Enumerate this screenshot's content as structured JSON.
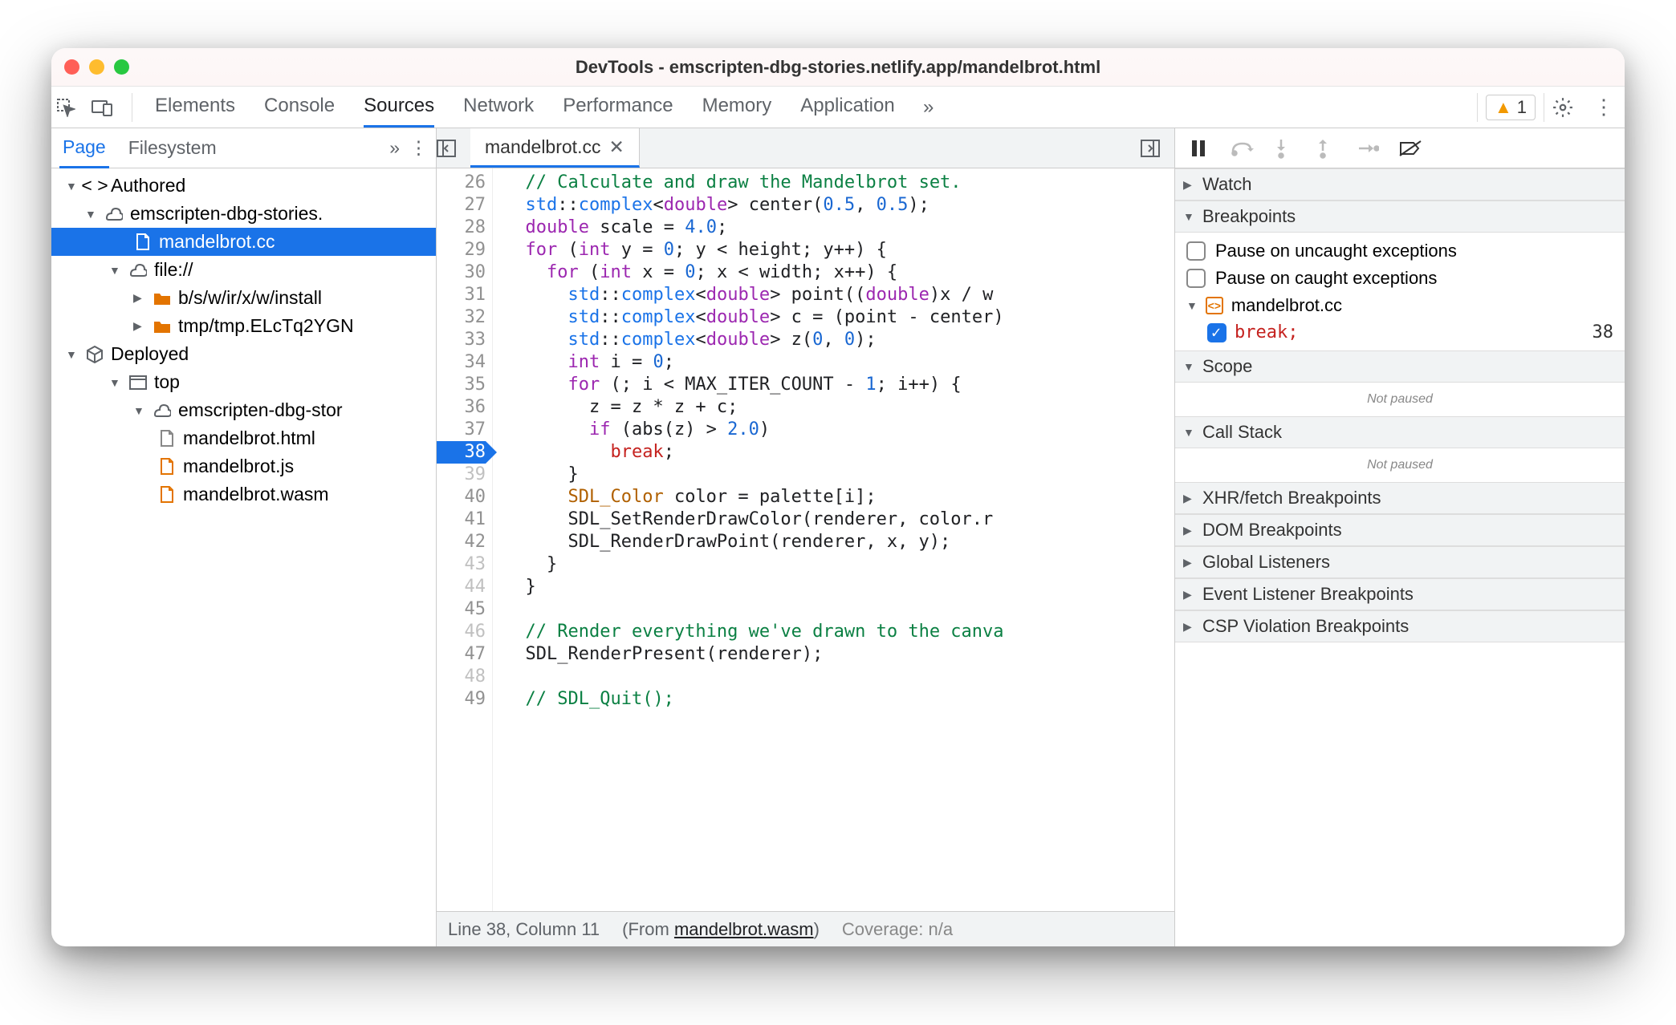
{
  "window": {
    "title": "DevTools - emscripten-dbg-stories.netlify.app/mandelbrot.html"
  },
  "toolbar": {
    "tabs": [
      "Elements",
      "Console",
      "Sources",
      "Network",
      "Performance",
      "Memory",
      "Application"
    ],
    "active": "Sources",
    "warning_count": "1"
  },
  "navigator": {
    "tabs": [
      "Page",
      "Filesystem"
    ],
    "active": "Page",
    "tree": {
      "authored": "Authored",
      "origin1": "emscripten-dbg-stories.",
      "file_cc": "mandelbrot.cc",
      "file_proto": "file://",
      "folder1": "b/s/w/ir/x/w/install",
      "folder2": "tmp/tmp.ELcTq2YGN",
      "deployed": "Deployed",
      "top": "top",
      "origin2": "emscripten-dbg-stor",
      "file_html": "mandelbrot.html",
      "file_js": "mandelbrot.js",
      "file_wasm": "mandelbrot.wasm"
    }
  },
  "editor": {
    "filename": "mandelbrot.cc",
    "lines": [
      {
        "n": "26",
        "cls": "",
        "html": "  <span class='c-comment'>// Calculate and draw the Mandelbrot set.</span>"
      },
      {
        "n": "27",
        "cls": "",
        "html": "  <span class='c-type'>std</span>::<span class='c-type'>complex</span>&lt;<span class='c-kw'>double</span>&gt; center(<span class='c-num'>0.5</span>, <span class='c-num'>0.5</span>);"
      },
      {
        "n": "28",
        "cls": "",
        "html": "  <span class='c-kw'>double</span> scale = <span class='c-num'>4.0</span>;"
      },
      {
        "n": "29",
        "cls": "",
        "html": "  <span class='c-kw'>for</span> (<span class='c-kw'>int</span> y = <span class='c-num'>0</span>; y &lt; height; y++) {"
      },
      {
        "n": "30",
        "cls": "",
        "html": "    <span class='c-kw'>for</span> (<span class='c-kw'>int</span> x = <span class='c-num'>0</span>; x &lt; width; x++) {"
      },
      {
        "n": "31",
        "cls": "",
        "html": "      <span class='c-type'>std</span>::<span class='c-type'>complex</span>&lt;<span class='c-kw'>double</span>&gt; point((<span class='c-kw'>double</span>)x / w"
      },
      {
        "n": "32",
        "cls": "",
        "html": "      <span class='c-type'>std</span>::<span class='c-type'>complex</span>&lt;<span class='c-kw'>double</span>&gt; c = (point - center)"
      },
      {
        "n": "33",
        "cls": "",
        "html": "      <span class='c-type'>std</span>::<span class='c-type'>complex</span>&lt;<span class='c-kw'>double</span>&gt; z(<span class='c-num'>0</span>, <span class='c-num'>0</span>);"
      },
      {
        "n": "34",
        "cls": "",
        "html": "      <span class='c-kw'>int</span> i = <span class='c-num'>0</span>;"
      },
      {
        "n": "35",
        "cls": "",
        "html": "      <span class='c-kw'>for</span> (; i &lt; MAX_ITER_COUNT - <span class='c-num'>1</span>; i++) {"
      },
      {
        "n": "36",
        "cls": "",
        "html": "        z = z * z + c;"
      },
      {
        "n": "37",
        "cls": "",
        "html": "        <span class='c-kw'>if</span> (abs(z) &gt; <span class='c-num'>2.0</span>)"
      },
      {
        "n": "38",
        "cls": "bp",
        "html": "          <span class='c-br'>break</span>;"
      },
      {
        "n": "39",
        "cls": "dim",
        "html": "      }"
      },
      {
        "n": "40",
        "cls": "",
        "html": "      <span class='c-id'>SDL_Color</span> color = palette[i];"
      },
      {
        "n": "41",
        "cls": "",
        "html": "      SDL_SetRenderDrawColor(renderer, color.r"
      },
      {
        "n": "42",
        "cls": "",
        "html": "      SDL_RenderDrawPoint(renderer, x, y);"
      },
      {
        "n": "43",
        "cls": "dim",
        "html": "    }"
      },
      {
        "n": "44",
        "cls": "dim",
        "html": "  }"
      },
      {
        "n": "45",
        "cls": "",
        "html": ""
      },
      {
        "n": "46",
        "cls": "dim",
        "html": "  <span class='c-comment'>// Render everything we've drawn to the canva</span>"
      },
      {
        "n": "47",
        "cls": "",
        "html": "  SDL_RenderPresent(renderer);"
      },
      {
        "n": "48",
        "cls": "dim",
        "html": ""
      },
      {
        "n": "49",
        "cls": "",
        "html": "  <span class='c-comment'>// SDL_Quit();</span>"
      }
    ],
    "status": {
      "pos": "Line 38, Column 11",
      "from_prefix": "(From ",
      "from_link": "mandelbrot.wasm",
      "from_suffix": ")",
      "coverage": "Coverage: n/a"
    }
  },
  "debugger": {
    "sections": {
      "watch": "Watch",
      "breakpoints": "Breakpoints",
      "scope": "Scope",
      "callstack": "Call Stack",
      "xhr": "XHR/fetch Breakpoints",
      "dom": "DOM Breakpoints",
      "global": "Global Listeners",
      "event": "Event Listener Breakpoints",
      "csp": "CSP Violation Breakpoints"
    },
    "pause_uncaught": "Pause on uncaught exceptions",
    "pause_caught": "Pause on caught exceptions",
    "bp_file": "mandelbrot.cc",
    "bp_text": "break;",
    "bp_line": "38",
    "not_paused": "Not paused"
  }
}
